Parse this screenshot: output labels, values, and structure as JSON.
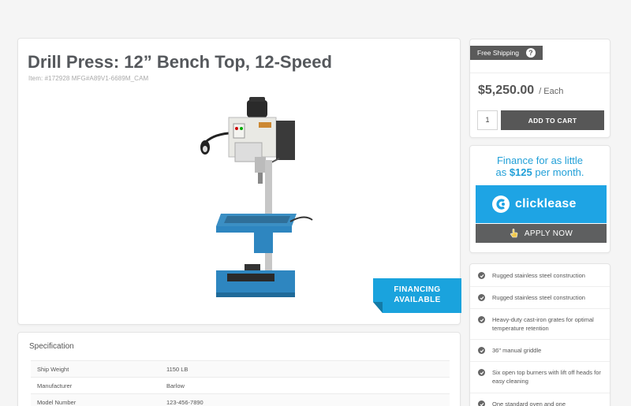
{
  "product": {
    "title": "Drill Press: 12” Bench Top, 12-Speed",
    "item_id": "Item: #172928 MFG#A89V1-6689M_CAM",
    "banner": {
      "line1": "FINANCING",
      "line2": "AVAILABLE"
    }
  },
  "specification": {
    "title": "Specification",
    "rows": [
      {
        "key": "Ship Weight",
        "value": "1150 LB"
      },
      {
        "key": "Manufacturer",
        "value": "Barlow"
      },
      {
        "key": "Model Number",
        "value": "123-456-7890"
      }
    ]
  },
  "purchase": {
    "shipping_label": "Free Shipping",
    "help_icon": "?",
    "price": "$5,250.00",
    "unit": "/ Each",
    "quantity": "1",
    "add_to_cart": "ADD TO CART"
  },
  "finance": {
    "line1": "Finance for as little",
    "line2_prefix": "as",
    "line2_amount": "$125",
    "line2_suffix": "per month.",
    "brand": "clicklease",
    "apply_label": "APPLY NOW",
    "brand_color": "#1ea4e4"
  },
  "features": [
    "Rugged stainless steel construction",
    "Rugged stainless steel construction",
    "Heavy-duty cast-iron grates for optimal temperature retention",
    "36\" manual griddle",
    "Six open top burners with lift off heads for easy cleaning",
    "One standard oven and one"
  ]
}
